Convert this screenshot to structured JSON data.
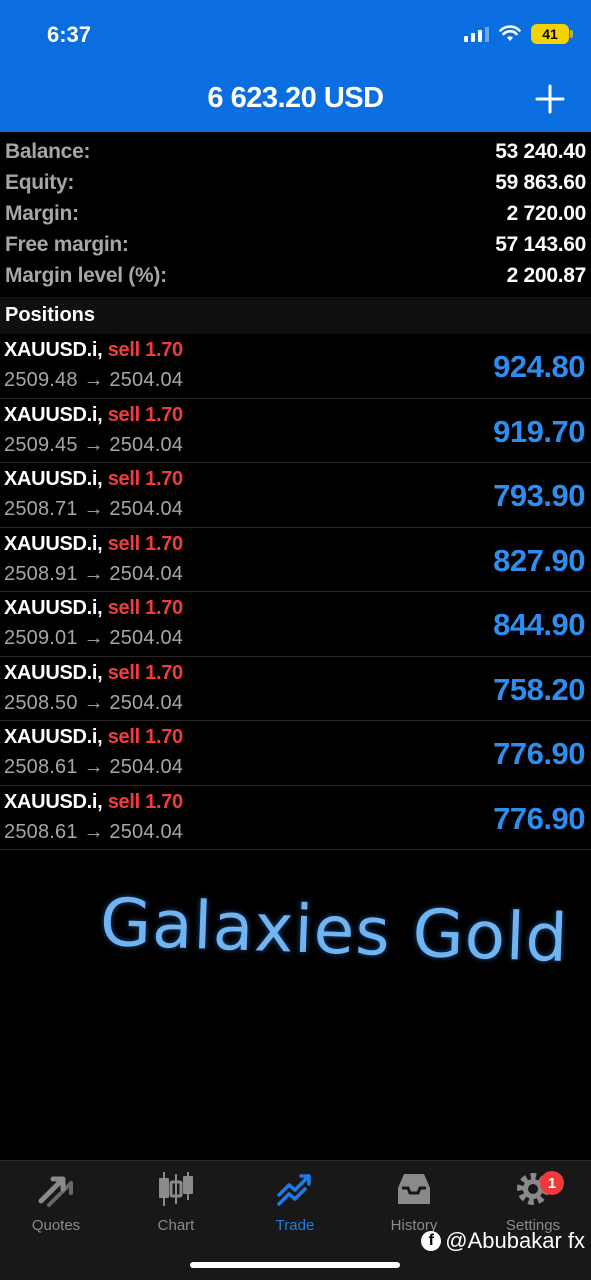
{
  "status": {
    "time": "6:37",
    "battery": "41"
  },
  "header": {
    "title": "6 623.20 USD",
    "add_icon": "plus-icon"
  },
  "summary": [
    {
      "label": "Balance:",
      "value": "53 240.40"
    },
    {
      "label": "Equity:",
      "value": "59 863.60"
    },
    {
      "label": "Margin:",
      "value": "2 720.00"
    },
    {
      "label": "Free margin:",
      "value": "57 143.60"
    },
    {
      "label": "Margin level (%):",
      "value": "2 200.87"
    }
  ],
  "positions_title": "Positions",
  "positions": [
    {
      "symbol": "XAUUSD.i,",
      "side": "sell 1.70",
      "prices": "2509.48 → 2504.04",
      "profit": "924.80"
    },
    {
      "symbol": "XAUUSD.i,",
      "side": "sell 1.70",
      "prices": "2509.45 → 2504.04",
      "profit": "919.70"
    },
    {
      "symbol": "XAUUSD.i,",
      "side": "sell 1.70",
      "prices": "2508.71 → 2504.04",
      "profit": "793.90"
    },
    {
      "symbol": "XAUUSD.i,",
      "side": "sell 1.70",
      "prices": "2508.91 → 2504.04",
      "profit": "827.90"
    },
    {
      "symbol": "XAUUSD.i,",
      "side": "sell 1.70",
      "prices": "2509.01 → 2504.04",
      "profit": "844.90"
    },
    {
      "symbol": "XAUUSD.i,",
      "side": "sell 1.70",
      "prices": "2508.50 → 2504.04",
      "profit": "758.20"
    },
    {
      "symbol": "XAUUSD.i,",
      "side": "sell 1.70",
      "prices": "2508.61 → 2504.04",
      "profit": "776.90"
    },
    {
      "symbol": "XAUUSD.i,",
      "side": "sell 1.70",
      "prices": "2508.61 → 2504.04",
      "profit": "776.90"
    }
  ],
  "watermark": "Galaxies Gold",
  "tabs": [
    {
      "label": "Quotes",
      "icon": "quotes-icon",
      "active": false
    },
    {
      "label": "Chart",
      "icon": "candlestick-chart-icon",
      "active": false
    },
    {
      "label": "Trade",
      "icon": "trade-icon",
      "active": true
    },
    {
      "label": "History",
      "icon": "history-inbox-icon",
      "active": false
    },
    {
      "label": "Settings",
      "icon": "gear-icon",
      "active": false,
      "badge": "1"
    }
  ],
  "credit": "@Abubakar fx",
  "colors": {
    "header": "#0b6ee0",
    "profit": "#2e8ef0",
    "sell": "#f23c3c",
    "active_tab": "#1e7ce8"
  }
}
